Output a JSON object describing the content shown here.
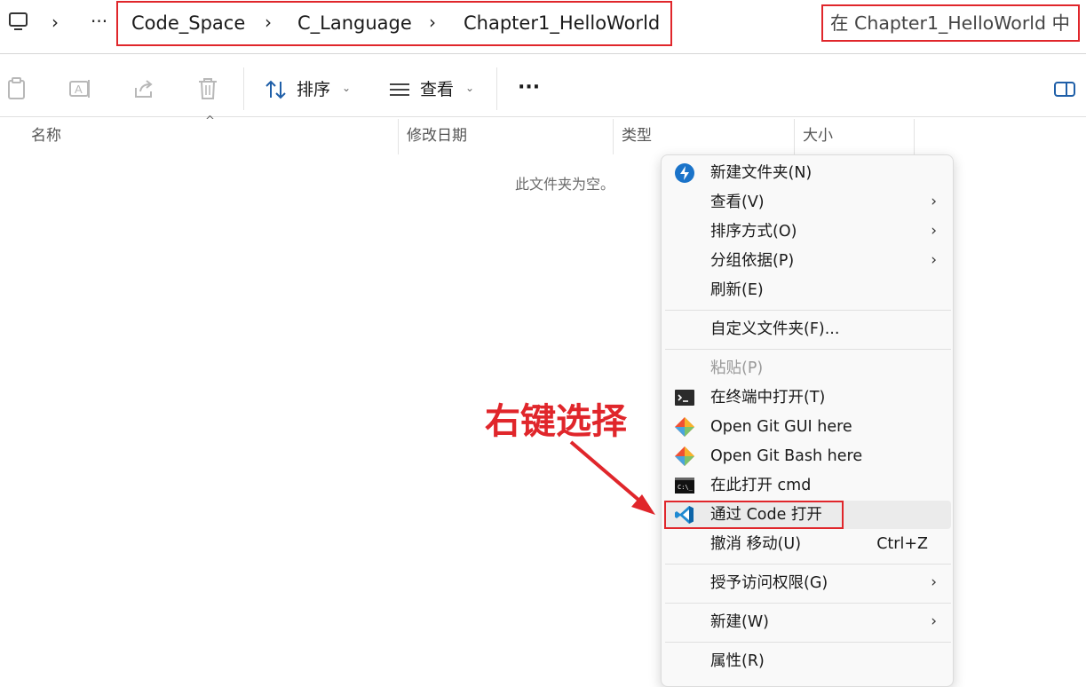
{
  "address": {
    "more": "···",
    "crumbs": [
      "Code_Space",
      "C_Language",
      "Chapter1_HelloWorld"
    ],
    "search_text": "在 Chapter1_HelloWorld 中"
  },
  "toolbar": {
    "sort_label": "排序",
    "view_label": "查看",
    "more": "···"
  },
  "columns": {
    "name": "名称",
    "modified": "修改日期",
    "type": "类型",
    "size": "大小"
  },
  "empty_message": "此文件夹为空。",
  "menu": {
    "new_folder": "新建文件夹(N)",
    "view": "查看(V)",
    "sort_by": "排序方式(O)",
    "group_by": "分组依据(P)",
    "refresh": "刷新(E)",
    "customize": "自定义文件夹(F)...",
    "paste": "粘贴(P)",
    "open_terminal": "在终端中打开(T)",
    "git_gui": "Open Git GUI here",
    "git_bash": "Open Git Bash here",
    "open_cmd": "在此打开 cmd",
    "open_code": "通过 Code 打开",
    "undo_move": "撤消 移动(U)",
    "undo_shortcut": "Ctrl+Z",
    "grant_access": "授予访问权限(G)",
    "new": "新建(W)",
    "properties": "属性(R)"
  },
  "annotation": {
    "text": "右键选择",
    "color": "#e0262b"
  }
}
